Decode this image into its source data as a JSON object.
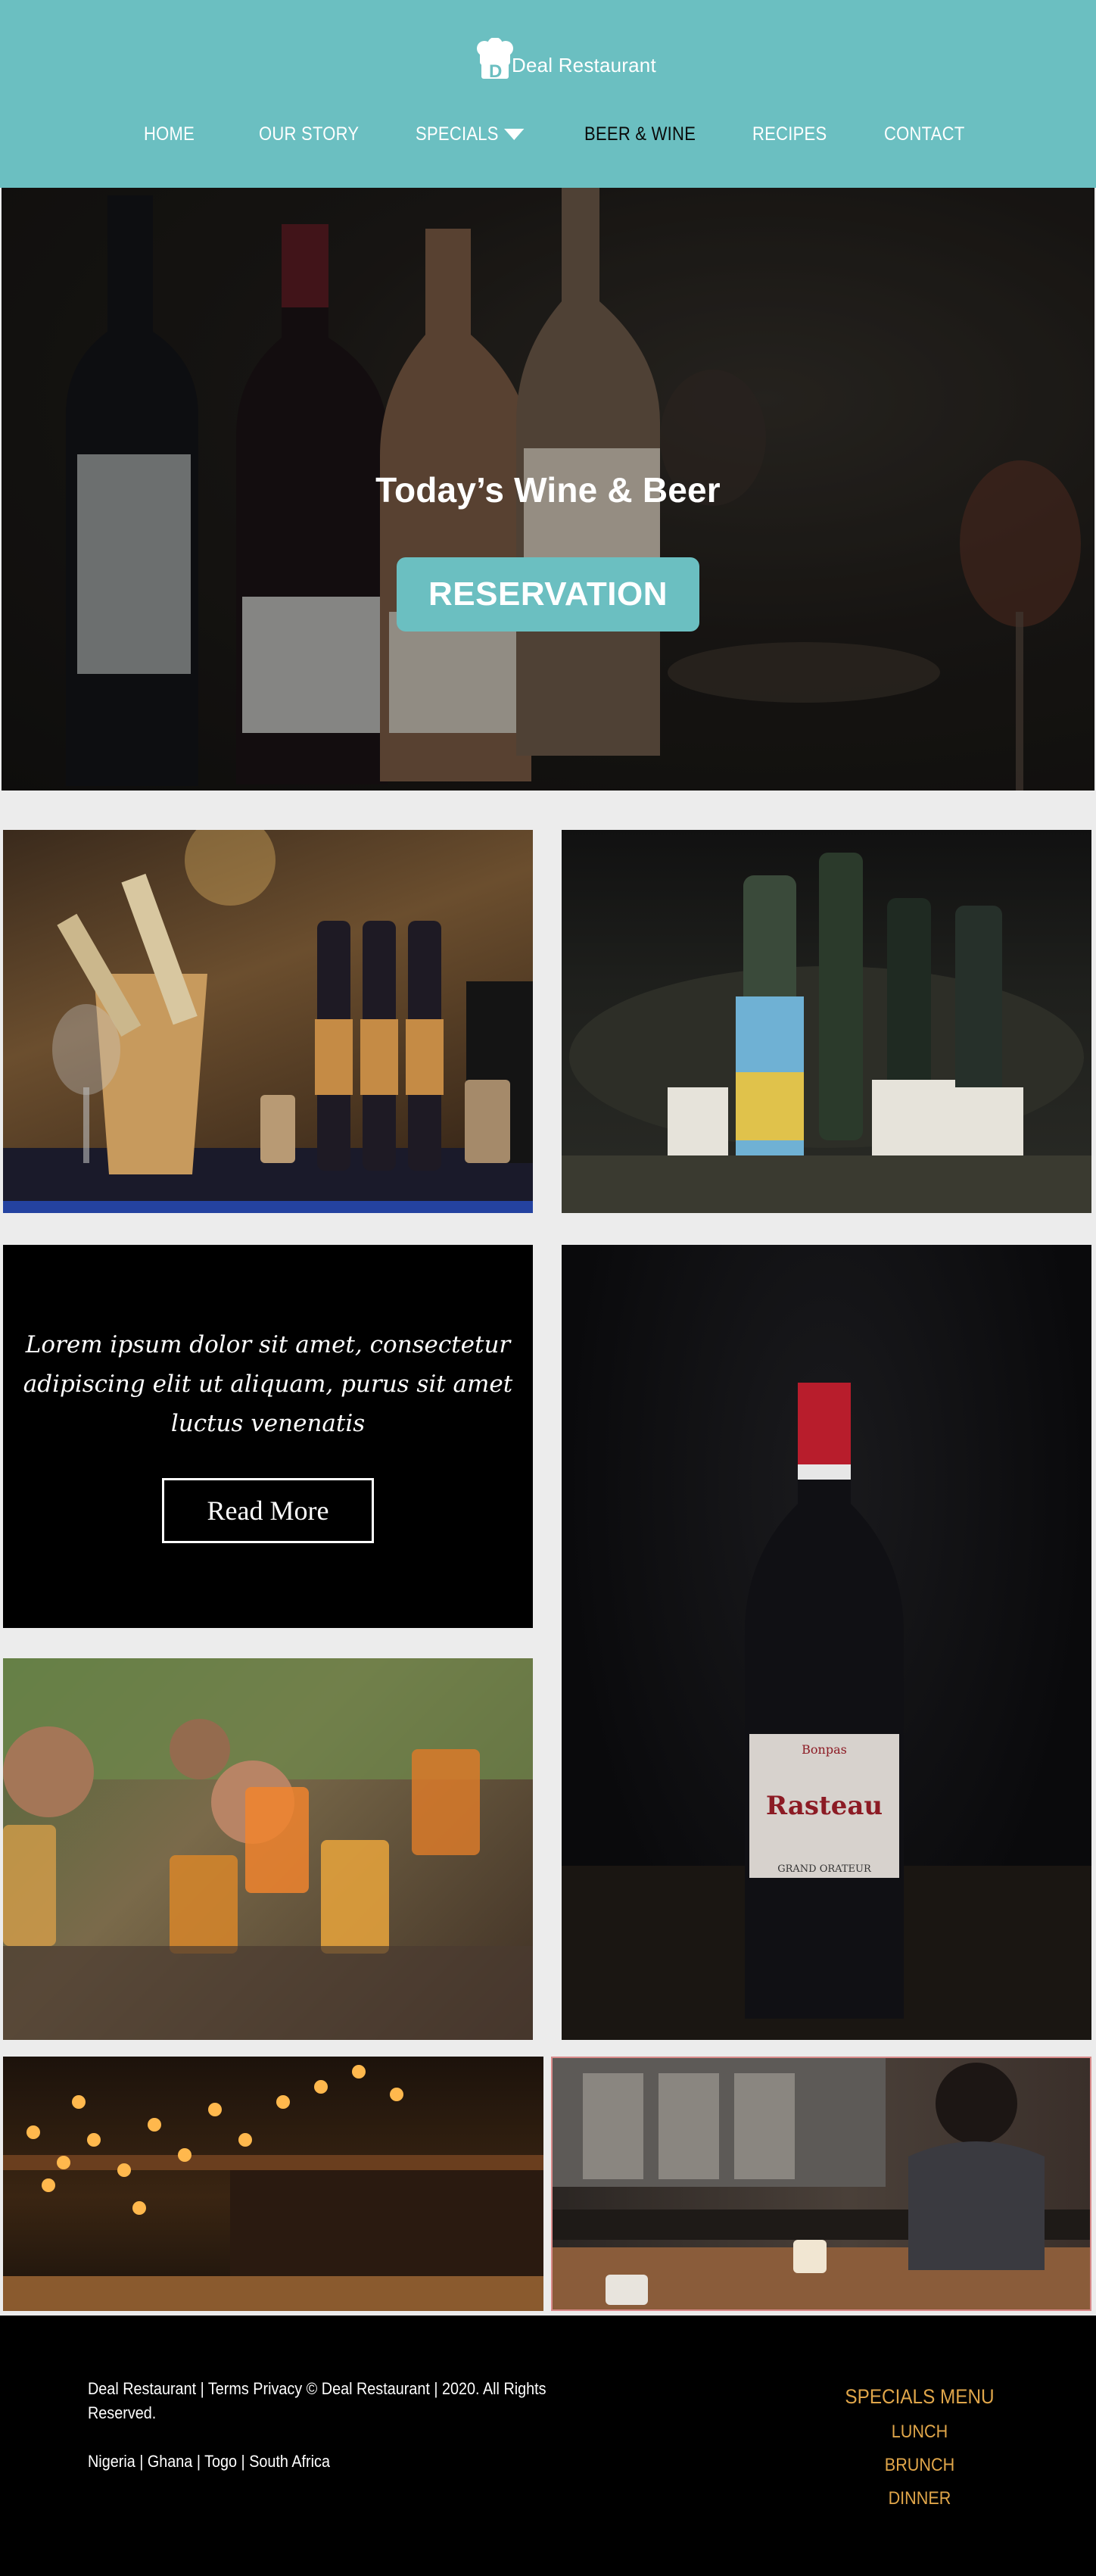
{
  "brand": {
    "name": "Deal Restaurant",
    "logo_icon": "chef-hat-icon",
    "colors": {
      "teal": "#6bbfc1",
      "gold": "#e0a64a",
      "black": "#000000"
    }
  },
  "nav": {
    "items": [
      {
        "label": "HOME"
      },
      {
        "label": "OUR STORY"
      },
      {
        "label": "SPECIALS"
      },
      {
        "label": "BEER & WINE"
      },
      {
        "label": "RECIPES"
      },
      {
        "label": "CONTACT"
      }
    ],
    "active": "BEER & WINE"
  },
  "hero": {
    "title": "Today’s Wine & Beer",
    "button": "RESERVATION"
  },
  "promo": {
    "text": "Lorem ipsum dolor sit amet, consectetur adipiscing elit ut aliquam, purus sit amet luctus venenatis",
    "button": "Read More"
  },
  "bottle_label": {
    "top": "Bonpas",
    "name": "Rasteau",
    "sub": "GRAND ORATEUR"
  },
  "footer": {
    "line1": "Deal Restaurant  | Terms Privacy © Deal Restaurant  |  2020. All Rights",
    "line2": "Reserved.",
    "locations": "Nigeria | Ghana | Togo | South Africa",
    "specials_title": "SPECIALS MENU",
    "specials": [
      "LUNCH",
      "BRUNCH",
      "DINNER"
    ]
  }
}
